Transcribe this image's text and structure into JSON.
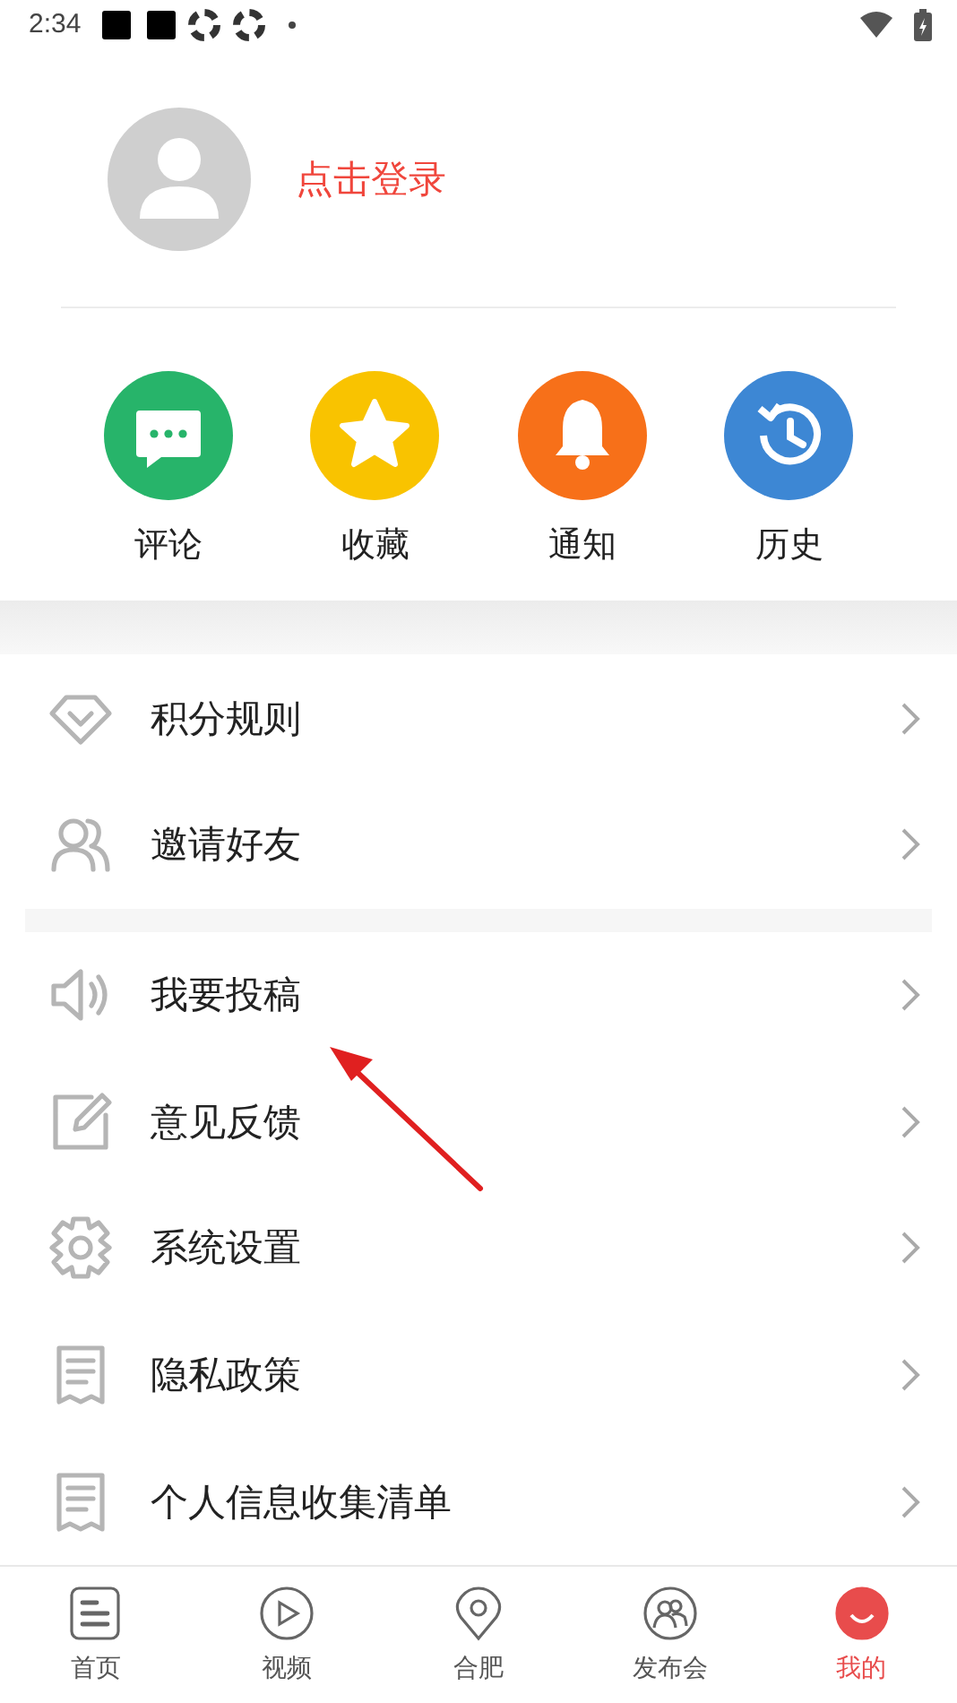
{
  "status_bar": {
    "time": "2:34"
  },
  "profile": {
    "login_text": "点击登录"
  },
  "shortcuts": [
    {
      "label": "评论",
      "kind": "comment",
      "color": "#27b46a"
    },
    {
      "label": "收藏",
      "kind": "star",
      "color": "#f9c300"
    },
    {
      "label": "通知",
      "kind": "bell",
      "color": "#f77019"
    },
    {
      "label": "历史",
      "kind": "history",
      "color": "#3d87d4"
    }
  ],
  "menu_groups": [
    [
      {
        "label": "积分规则",
        "kind": "diamond"
      },
      {
        "label": "邀请好友",
        "kind": "people"
      }
    ],
    [
      {
        "label": "我要投稿",
        "kind": "speaker"
      },
      {
        "label": "意见反馈",
        "kind": "edit"
      },
      {
        "label": "系统设置",
        "kind": "gear"
      },
      {
        "label": "隐私政策",
        "kind": "doc"
      },
      {
        "label": "个人信息收集清单",
        "kind": "doc"
      }
    ]
  ],
  "bottom_nav": [
    {
      "label": "首页",
      "kind": "home",
      "selected": false
    },
    {
      "label": "视频",
      "kind": "video",
      "selected": false
    },
    {
      "label": "合肥",
      "kind": "pin",
      "selected": false
    },
    {
      "label": "发布会",
      "kind": "group",
      "selected": false
    },
    {
      "label": "我的",
      "kind": "me",
      "selected": true
    }
  ]
}
